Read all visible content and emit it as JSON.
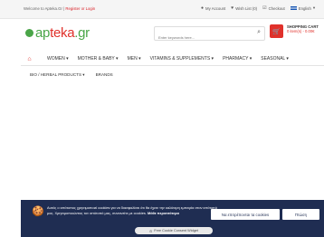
{
  "topbar": {
    "welcome_text": "Welcome to Apteka.Gr |",
    "register_login": "Register or Login",
    "my_account": "My Account",
    "wish_list": "Wish List (0)",
    "checkout": "Checkout",
    "language": "English"
  },
  "logo": {
    "prefix": "",
    "a": "ap",
    "b": "teka",
    "suffix": ".gr"
  },
  "search": {
    "placeholder": "Enter keywords here..."
  },
  "cart": {
    "title": "SHOPPING CART",
    "summary": "0 item(s) - 0.00€"
  },
  "nav": {
    "items": [
      "WOMEN ▾",
      "MOTHER & BABY ▾",
      "MEN ▾",
      "VITAMINS & SUPPLEMENTS ▾",
      "PHARMACY ▾",
      "SEASONAL ▾"
    ]
  },
  "subnav": {
    "items": [
      "BIO / HERBAL PRODUCTS ▾",
      "BRANDS"
    ]
  },
  "cookie": {
    "text_main": "Αυτός ο ιστότοπος χρησιμοποιεί cookies για να διασφαλίσει ότι θα έχετε την καλύτερη εμπειρία στον ιστότοπό μας. Χρησιμοποιώντας τον ιστότοπό μας, συναινείτε με cookies.",
    "learn_more": "Μάθε περισσότερα",
    "accept_label": "Να επιτρέπονται τα cookies",
    "reject_label": "Πτώση",
    "widget_label": "Free Cookie Consent Widget"
  },
  "colors": {
    "brand_red": "#e0312b",
    "brand_green": "#4aa548",
    "cookie_bg": "#1f2d52"
  }
}
